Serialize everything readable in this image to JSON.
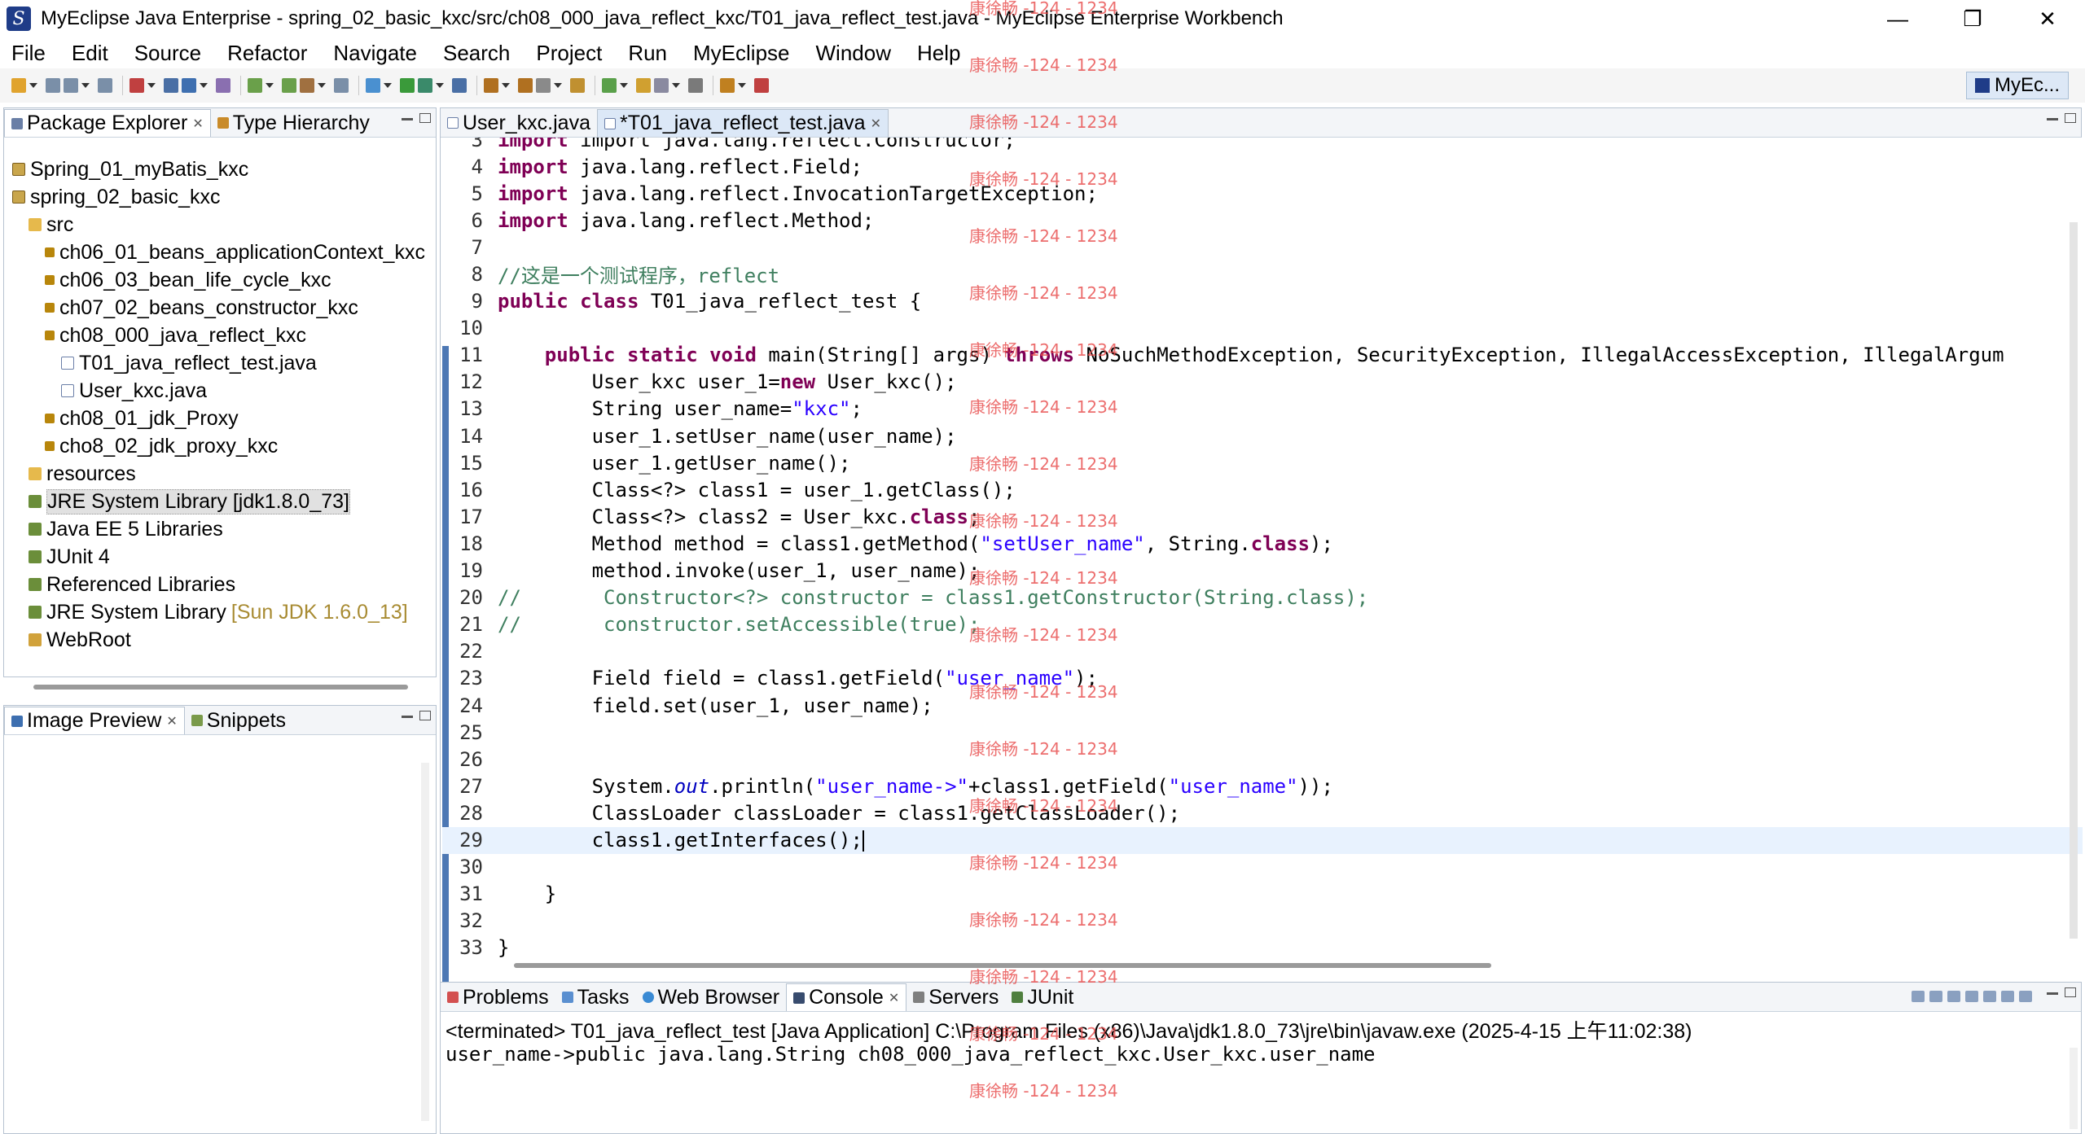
{
  "window": {
    "title": "MyEclipse Java Enterprise - spring_02_basic_kxc/src/ch08_000_java_reflect_kxc/T01_java_reflect_test.java - MyEclipse Enterprise Workbench",
    "minimize": "—",
    "maximize": "❐",
    "close": "✕"
  },
  "menu": [
    "File",
    "Edit",
    "Source",
    "Refactor",
    "Navigate",
    "Search",
    "Project",
    "Run",
    "MyEclipse",
    "Window",
    "Help"
  ],
  "perspective": {
    "label": "MyEc..."
  },
  "package_explorer": {
    "tabs": {
      "package_explorer": "Package Explorer",
      "type_hierarchy": "Type Hierarchy"
    },
    "tree": [
      {
        "label": "Spring_01_myBatis_kxc",
        "icon": "project",
        "indent": 0
      },
      {
        "label": "spring_02_basic_kxc",
        "icon": "project",
        "indent": 0
      },
      {
        "label": "src",
        "icon": "folder",
        "indent": 1
      },
      {
        "label": "ch06_01_beans_applicationContext_kxc",
        "icon": "pkg",
        "indent": 2
      },
      {
        "label": "ch06_03_bean_life_cycle_kxc",
        "icon": "pkg",
        "indent": 2
      },
      {
        "label": "ch07_02_beans_constructor_kxc",
        "icon": "pkg",
        "indent": 2
      },
      {
        "label": "ch08_000_java_reflect_kxc",
        "icon": "pkg",
        "indent": 2
      },
      {
        "label": "T01_java_reflect_test.java",
        "icon": "java",
        "indent": 3
      },
      {
        "label": "User_kxc.java",
        "icon": "java",
        "indent": 3
      },
      {
        "label": "ch08_01_jdk_Proxy",
        "icon": "pkg",
        "indent": 2
      },
      {
        "label": "cho8_02_jdk_proxy_kxc",
        "icon": "pkg",
        "indent": 2
      },
      {
        "label": "resources",
        "icon": "folder",
        "indent": 1
      },
      {
        "label": "JRE System Library [jdk1.8.0_73]",
        "icon": "lib",
        "indent": 1,
        "selected": true
      },
      {
        "label": "Java EE 5 Libraries",
        "icon": "lib",
        "indent": 1
      },
      {
        "label": "JUnit 4",
        "icon": "lib",
        "indent": 1
      },
      {
        "label": "Referenced Libraries",
        "icon": "lib",
        "indent": 1
      },
      {
        "label": "JRE System Library",
        "note": "[Sun JDK 1.6.0_13]",
        "icon": "lib",
        "indent": 1
      },
      {
        "label": "WebRoot",
        "icon": "web",
        "indent": 1
      }
    ]
  },
  "image_preview": {
    "tabs": {
      "image_preview": "Image Preview",
      "snippets": "Snippets"
    }
  },
  "editor": {
    "tabs": {
      "user_kxc": "User_kxc.java",
      "t01": "*T01_java_reflect_test.java"
    },
    "first_line_partial": "import java.lang.reflect.Constructor;",
    "lines": [
      {
        "n": "4",
        "html": "<span class='kw'>import</span> java.lang.reflect.Field;"
      },
      {
        "n": "5",
        "html": "<span class='kw'>import</span> java.lang.reflect.InvocationTargetException;"
      },
      {
        "n": "6",
        "html": "<span class='kw'>import</span> java.lang.reflect.Method;"
      },
      {
        "n": "7",
        "html": ""
      },
      {
        "n": "8",
        "html": "<span class='cmt'>//这是一个测试程序，reflect</span>"
      },
      {
        "n": "9",
        "html": "<span class='kw'>public</span> <span class='kw'>class</span> T01_java_reflect_test {"
      },
      {
        "n": "10",
        "html": ""
      },
      {
        "n": "11",
        "html": "    <span class='kw'>public</span> <span class='kw'>static</span> <span class='kw'>void</span> main(String[] args) <span class='kw'>throws</span> NoSuchMethodException, SecurityException, IllegalAccessException, IllegalArgum"
      },
      {
        "n": "12",
        "html": "        User_kxc user_1=<span class='kw'>new</span> User_kxc();"
      },
      {
        "n": "13",
        "html": "        String user_name=<span class='str'>\"kxc\"</span>;"
      },
      {
        "n": "14",
        "html": "        user_1.setUser_name(user_name);"
      },
      {
        "n": "15",
        "html": "        user_1.getUser_name();"
      },
      {
        "n": "16",
        "html": "        Class&lt;?&gt; class1 = user_1.getClass();"
      },
      {
        "n": "17",
        "html": "        Class&lt;?&gt; class2 = User_kxc.<span class='kw'>class</span>;"
      },
      {
        "n": "18",
        "html": "        Method method = class1.getMethod(<span class='str'>\"setUser_name\"</span>, String.<span class='kw'>class</span>);"
      },
      {
        "n": "19",
        "html": "        method.invoke(user_1, user_name);"
      },
      {
        "n": "20",
        "html": "<span class='cmt'>//       Constructor&lt;?&gt; constructor = class1.getConstructor(String.class);</span>"
      },
      {
        "n": "21",
        "html": "<span class='cmt'>//       constructor.setAccessible(true);</span>"
      },
      {
        "n": "22",
        "html": ""
      },
      {
        "n": "23",
        "html": "        Field field = class1.getField(<span class='str'>\"user_name\"</span>);"
      },
      {
        "n": "24",
        "html": "        field.set(user_1, user_name);"
      },
      {
        "n": "25",
        "html": ""
      },
      {
        "n": "26",
        "html": ""
      },
      {
        "n": "27",
        "html": "        System.<span class='ital'>out</span>.println(<span class='str'>\"user_name-&gt;\"</span>+class1.getField(<span class='str'>\"user_name\"</span>));"
      },
      {
        "n": "28",
        "html": "        ClassLoader classLoader = class1.getClassLoader();"
      },
      {
        "n": "29",
        "html": "        class1.getInterfaces();<span class='cursor'></span>",
        "current": true
      },
      {
        "n": "30",
        "html": ""
      },
      {
        "n": "31",
        "html": "    }"
      },
      {
        "n": "32",
        "html": ""
      },
      {
        "n": "33",
        "html": "}"
      }
    ]
  },
  "console": {
    "tabs": {
      "problems": "Problems",
      "tasks": "Tasks",
      "web_browser": "Web Browser",
      "console": "Console",
      "servers": "Servers",
      "junit": "JUnit"
    },
    "header": "<terminated> T01_java_reflect_test [Java Application] C:\\Program Files (x86)\\Java\\jdk1.8.0_73\\jre\\bin\\javaw.exe (2025-4-15 上午11:02:38)",
    "output": "user_name->public java.lang.String ch08_000_java_reflect_kxc.User_kxc.user_name"
  },
  "watermark": "康徐畅 -124 - 1234"
}
